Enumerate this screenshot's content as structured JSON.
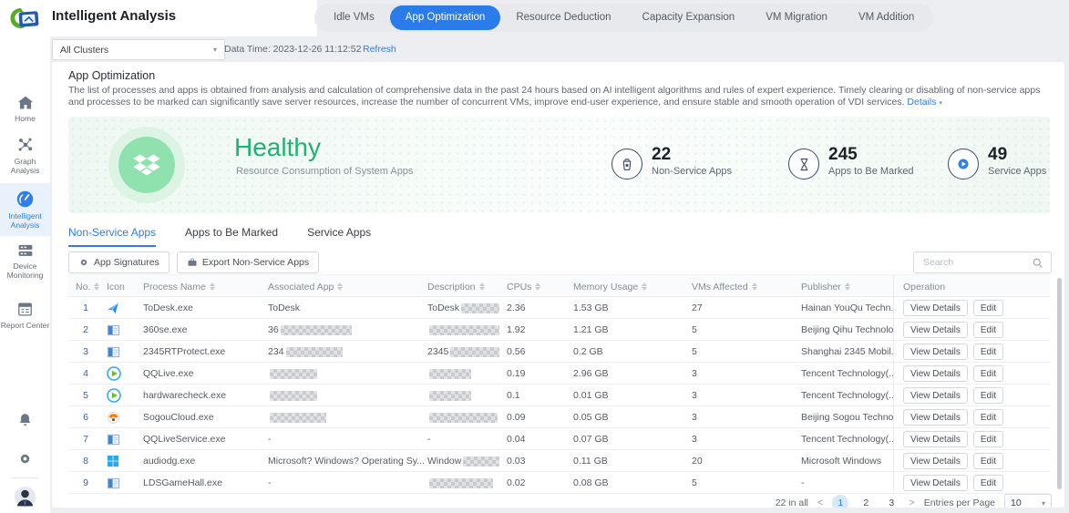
{
  "colors": {
    "accent_blue": "#2b7ce9",
    "link_blue": "#2f7be8",
    "healthy_green": "#1fb272",
    "page_bg": "#edeef2",
    "sidebar_active_bg": "#e9f1fd"
  },
  "header": {
    "title": "Intelligent Analysis",
    "tabs": [
      "Idle VMs",
      "App Optimization",
      "Resource Deduction",
      "Capacity Expansion",
      "VM Migration",
      "VM Addition"
    ],
    "active_tab": "App Optimization",
    "cluster_select": "All Clusters",
    "data_time": "Data Time: 2023-12-26 11:12:52",
    "refresh_label": "Refresh"
  },
  "sidebar": {
    "items": [
      {
        "label": "Home",
        "icon": "home-icon"
      },
      {
        "label": "Graph Analysis",
        "icon": "graph-analysis-icon"
      },
      {
        "label": "Intelligent Analysis",
        "icon": "intelligent-analysis-icon",
        "active": true
      },
      {
        "label": "Device Monitoring",
        "icon": "device-monitoring-icon"
      },
      {
        "label": "Report Center",
        "icon": "report-center-icon"
      }
    ],
    "bottom_icons": [
      "bell-icon",
      "gear-icon",
      "avatar"
    ]
  },
  "page": {
    "section_title": "App Optimization",
    "description": "The list of processes and apps is obtained from analysis and calculation of comprehensive data in the past 24 hours based on AI intelligent algorithms and rules of expert experience. Timely clearing or disabling of non-service apps and processes to be marked can significantly save server resources, increase the number of concurrent VMs, improve end-user experience, and ensure stable and smooth operation of VDI services.",
    "details_label": "Details"
  },
  "health": {
    "status": "Healthy",
    "subtitle": "Resource Consumption of System Apps",
    "status_icon": "diamond-cluster-icon",
    "stats": [
      {
        "value": "22",
        "label": "Non-Service Apps",
        "icon": "trash-star-icon"
      },
      {
        "value": "245",
        "label": "Apps to Be Marked",
        "icon": "hourglass-icon"
      },
      {
        "value": "49",
        "label": "Service Apps",
        "icon": "play-circle-icon"
      }
    ]
  },
  "app_tabs": [
    {
      "label": "Non-Service Apps",
      "active": true
    },
    {
      "label": "Apps to Be Marked",
      "active": false
    },
    {
      "label": "Service Apps",
      "active": false
    }
  ],
  "toolbar": {
    "app_signatures_label": "App Signatures",
    "export_label": "Export Non-Service Apps",
    "search_placeholder": "Search"
  },
  "table": {
    "columns": [
      {
        "label": "No.",
        "sortable": true
      },
      {
        "label": "Icon",
        "sortable": false
      },
      {
        "label": "Process Name",
        "sortable": true
      },
      {
        "label": "Associated App",
        "sortable": true
      },
      {
        "label": "Description",
        "sortable": true
      },
      {
        "label": "CPUs",
        "sortable": true
      },
      {
        "label": "Memory Usage",
        "sortable": true
      },
      {
        "label": "VMs Affected",
        "sortable": true
      },
      {
        "label": "Publisher",
        "sortable": true
      },
      {
        "label": "Operation",
        "sortable": false
      }
    ],
    "actions": [
      "View Details",
      "Edit"
    ],
    "rows": [
      {
        "no": "1",
        "icon": "todesk-icon",
        "process": "ToDesk.exe",
        "app": "ToDesk",
        "desc": {
          "text": "ToDesk",
          "blur": 72
        },
        "cpus": "2.36",
        "mem": "1.53 GB",
        "vms": "27",
        "pub": "Hainan YouQu Techn..."
      },
      {
        "no": "2",
        "icon": "browser-window-icon",
        "process": "360se.exe",
        "app": {
          "text": "36",
          "blur": 78
        },
        "desc": {
          "text": "",
          "blur": 78
        },
        "cpus": "1.92",
        "mem": "1.21 GB",
        "vms": "5",
        "pub": "Beijing Qihu Technolo..."
      },
      {
        "no": "3",
        "icon": "browser-window-icon",
        "process": "2345RTProtect.exe",
        "app": {
          "text": "234",
          "blur": 62
        },
        "desc": {
          "text": "2345",
          "blur": 55
        },
        "cpus": "0.56",
        "mem": "0.2 GB",
        "vms": "5",
        "pub": "Shanghai 2345 Mobil..."
      },
      {
        "no": "4",
        "icon": "play-green-icon",
        "process": "QQLive.exe",
        "app": {
          "text": "",
          "blur": 52
        },
        "desc": {
          "text": "",
          "blur": 46
        },
        "cpus": "0.19",
        "mem": "2.96 GB",
        "vms": "3",
        "pub": "Tencent Technology(..."
      },
      {
        "no": "5",
        "icon": "play-green-icon",
        "process": "hardwarecheck.exe",
        "app": {
          "text": "",
          "blur": 52
        },
        "desc": {
          "text": "",
          "blur": 46
        },
        "cpus": "0.1",
        "mem": "0.01 GB",
        "vms": "3",
        "pub": "Tencent Technology(..."
      },
      {
        "no": "6",
        "icon": "sogou-icon",
        "process": "SogouCloud.exe",
        "app": {
          "text": "",
          "blur": 62
        },
        "desc": {
          "text": "",
          "blur": 75
        },
        "cpus": "0.09",
        "mem": "0.05 GB",
        "vms": "3",
        "pub": "Beijing Sogou Techno..."
      },
      {
        "no": "7",
        "icon": "browser-window-icon",
        "process": "QQLiveService.exe",
        "app": "-",
        "desc": "-",
        "cpus": "0.04",
        "mem": "0.07 GB",
        "vms": "3",
        "pub": "Tencent Technology(..."
      },
      {
        "no": "8",
        "icon": "windows-icon",
        "process": "audiodg.exe",
        "app": "Microsoft? Windows? Operating Sy...",
        "desc": {
          "text": "Window",
          "blur": 60
        },
        "cpus": "0.03",
        "mem": "0.11 GB",
        "vms": "20",
        "pub": "Microsoft Windows"
      },
      {
        "no": "9",
        "icon": "browser-window-icon",
        "process": "LDSGameHall.exe",
        "app": "-",
        "desc": {
          "text": "",
          "blur": 70
        },
        "cpus": "0.02",
        "mem": "0.08 GB",
        "vms": "5",
        "pub": "-"
      }
    ]
  },
  "pagination": {
    "total_label": "22 in all",
    "pages": [
      "1",
      "2",
      "3"
    ],
    "current": "1",
    "entries_label": "Entries per Page",
    "entries_value": "10"
  }
}
